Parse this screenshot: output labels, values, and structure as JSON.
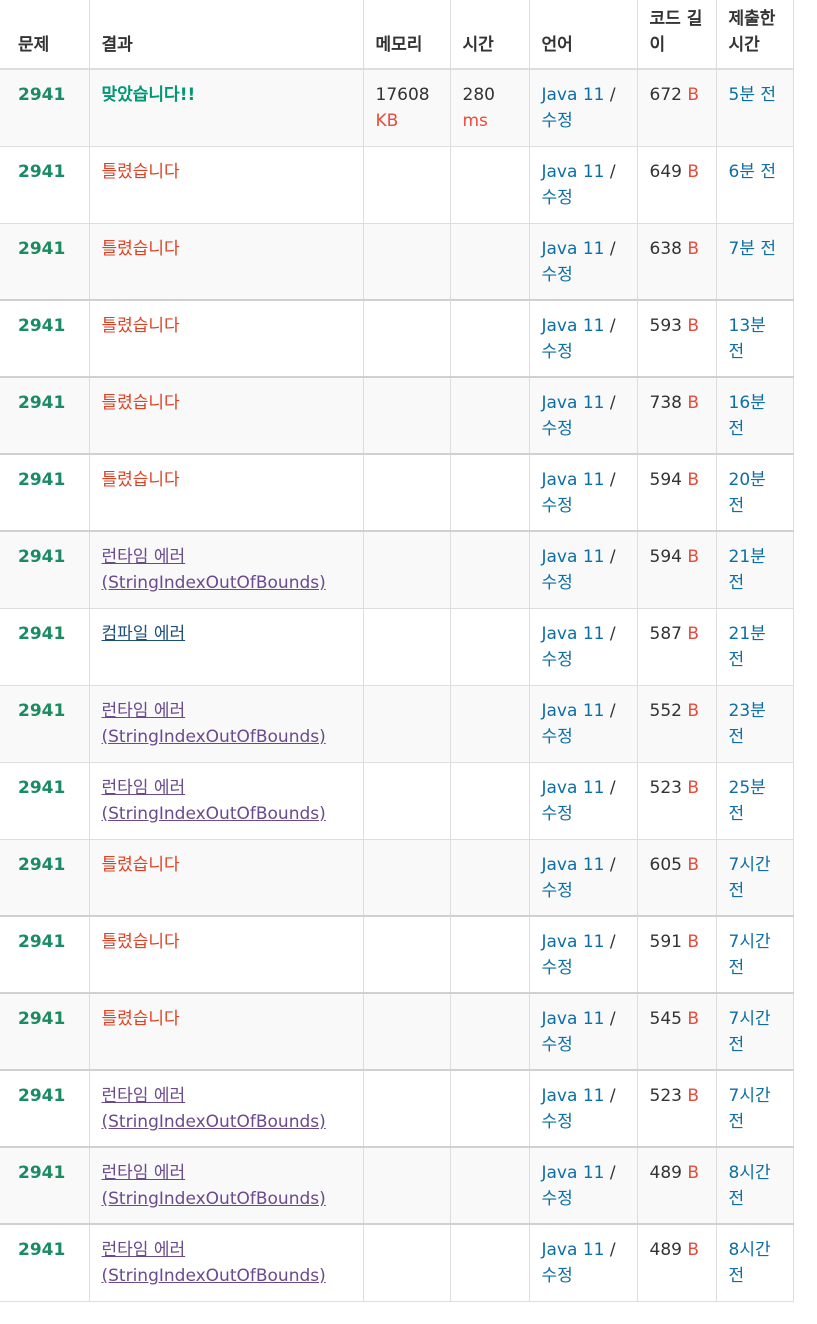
{
  "table": {
    "headers": {
      "problem": "문제",
      "result": "결과",
      "memory": "메모리",
      "time": "시간",
      "language": "언어",
      "code_length": "코드 길이",
      "submitted": "제출한 시간"
    },
    "rows": [
      {
        "problem": "2941",
        "result": "맞았습니다!!",
        "result_type": "ac",
        "memory": "17608",
        "memory_unit": "KB",
        "time": "280",
        "time_unit": "ms",
        "lang": "Java 11",
        "edit": "수정",
        "sep": "/",
        "len": "672",
        "len_unit": "B",
        "submitted": "5분 전"
      },
      {
        "problem": "2941",
        "result": "틀렸습니다",
        "result_type": "wa",
        "memory": "",
        "memory_unit": "",
        "time": "",
        "time_unit": "",
        "lang": "Java 11",
        "edit": "수정",
        "sep": "/",
        "len": "649",
        "len_unit": "B",
        "submitted": "6분 전"
      },
      {
        "problem": "2941",
        "result": "틀렸습니다",
        "result_type": "wa",
        "memory": "",
        "memory_unit": "",
        "time": "",
        "time_unit": "",
        "lang": "Java 11",
        "edit": "수정",
        "sep": "/",
        "len": "638",
        "len_unit": "B",
        "submitted": "7분 전"
      },
      {
        "problem": "2941",
        "result": "틀렸습니다",
        "result_type": "wa",
        "memory": "",
        "memory_unit": "",
        "time": "",
        "time_unit": "",
        "lang": "Java 11",
        "edit": "수정",
        "sep": "/",
        "len": "593",
        "len_unit": "B",
        "submitted": "13분 전"
      },
      {
        "problem": "2941",
        "result": "틀렸습니다",
        "result_type": "wa",
        "memory": "",
        "memory_unit": "",
        "time": "",
        "time_unit": "",
        "lang": "Java 11",
        "edit": "수정",
        "sep": "/",
        "len": "738",
        "len_unit": "B",
        "submitted": "16분 전"
      },
      {
        "problem": "2941",
        "result": "틀렸습니다",
        "result_type": "wa",
        "memory": "",
        "memory_unit": "",
        "time": "",
        "time_unit": "",
        "lang": "Java 11",
        "edit": "수정",
        "sep": "/",
        "len": "594",
        "len_unit": "B",
        "submitted": "20분 전"
      },
      {
        "problem": "2941",
        "result": "런타임 에러 (StringIndexOutOfBounds)",
        "result_type": "rte",
        "memory": "",
        "memory_unit": "",
        "time": "",
        "time_unit": "",
        "lang": "Java 11",
        "edit": "수정",
        "sep": "/",
        "len": "594",
        "len_unit": "B",
        "submitted": "21분 전"
      },
      {
        "problem": "2941",
        "result": "컴파일 에러",
        "result_type": "ce",
        "memory": "",
        "memory_unit": "",
        "time": "",
        "time_unit": "",
        "lang": "Java 11",
        "edit": "수정",
        "sep": "/",
        "len": "587",
        "len_unit": "B",
        "submitted": "21분 전"
      },
      {
        "problem": "2941",
        "result": "런타임 에러 (StringIndexOutOfBounds)",
        "result_type": "rte",
        "memory": "",
        "memory_unit": "",
        "time": "",
        "time_unit": "",
        "lang": "Java 11",
        "edit": "수정",
        "sep": "/",
        "len": "552",
        "len_unit": "B",
        "submitted": "23분 전"
      },
      {
        "problem": "2941",
        "result": "런타임 에러 (StringIndexOutOfBounds)",
        "result_type": "rte",
        "memory": "",
        "memory_unit": "",
        "time": "",
        "time_unit": "",
        "lang": "Java 11",
        "edit": "수정",
        "sep": "/",
        "len": "523",
        "len_unit": "B",
        "submitted": "25분 전"
      },
      {
        "problem": "2941",
        "result": "틀렸습니다",
        "result_type": "wa",
        "memory": "",
        "memory_unit": "",
        "time": "",
        "time_unit": "",
        "lang": "Java 11",
        "edit": "수정",
        "sep": "/",
        "len": "605",
        "len_unit": "B",
        "submitted": "7시간 전"
      },
      {
        "problem": "2941",
        "result": "틀렸습니다",
        "result_type": "wa",
        "memory": "",
        "memory_unit": "",
        "time": "",
        "time_unit": "",
        "lang": "Java 11",
        "edit": "수정",
        "sep": "/",
        "len": "591",
        "len_unit": "B",
        "submitted": "7시간 전"
      },
      {
        "problem": "2941",
        "result": "틀렸습니다",
        "result_type": "wa",
        "memory": "",
        "memory_unit": "",
        "time": "",
        "time_unit": "",
        "lang": "Java 11",
        "edit": "수정",
        "sep": "/",
        "len": "545",
        "len_unit": "B",
        "submitted": "7시간 전"
      },
      {
        "problem": "2941",
        "result": "런타임 에러 (StringIndexOutOfBounds)",
        "result_type": "rte",
        "memory": "",
        "memory_unit": "",
        "time": "",
        "time_unit": "",
        "lang": "Java 11",
        "edit": "수정",
        "sep": "/",
        "len": "523",
        "len_unit": "B",
        "submitted": "7시간 전"
      },
      {
        "problem": "2941",
        "result": "런타임 에러 (StringIndexOutOfBounds)",
        "result_type": "rte",
        "memory": "",
        "memory_unit": "",
        "time": "",
        "time_unit": "",
        "lang": "Java 11",
        "edit": "수정",
        "sep": "/",
        "len": "489",
        "len_unit": "B",
        "submitted": "8시간 전"
      },
      {
        "problem": "2941",
        "result": "런타임 에러 (StringIndexOutOfBounds)",
        "result_type": "rte",
        "memory": "",
        "memory_unit": "",
        "time": "",
        "time_unit": "",
        "lang": "Java 11",
        "edit": "수정",
        "sep": "/",
        "len": "489",
        "len_unit": "B",
        "submitted": "8시간 전"
      }
    ]
  },
  "colors": {
    "problem": "#1a8b63",
    "accepted": "#009874",
    "wrong": "#dd4124",
    "runtime_error": "#6a4a8e",
    "compile_error": "#1c4f7c",
    "unit": "#e74c3c",
    "link": "#0d6ea5"
  }
}
